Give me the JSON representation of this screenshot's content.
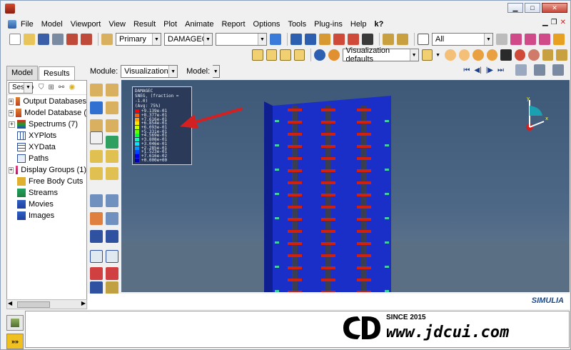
{
  "window": {
    "minimize": "▁",
    "maximize": "□",
    "close": "✕"
  },
  "menu": [
    {
      "label": "File"
    },
    {
      "label": "Model"
    },
    {
      "label": "Viewport"
    },
    {
      "label": "View"
    },
    {
      "label": "Result"
    },
    {
      "label": "Plot"
    },
    {
      "label": "Animate"
    },
    {
      "label": "Report"
    },
    {
      "label": "Options"
    },
    {
      "label": "Tools"
    },
    {
      "label": "Plug-ins"
    },
    {
      "label": "Help"
    },
    {
      "label": "k?"
    }
  ],
  "toolbar": {
    "primary_combo": "Primary",
    "field_combo": "DAMAGEC",
    "empty_combo": "",
    "selection_combo": "All",
    "vis_defaults": "Visualization defaults"
  },
  "tabs": {
    "model": "Model",
    "results": "Results"
  },
  "module": {
    "label": "Module:",
    "value": "Visualization",
    "model_label": "Model:"
  },
  "tree": {
    "session_combo": "Sessio",
    "items": [
      {
        "label": "Output Databases",
        "expandable": true
      },
      {
        "label": "Model Database (",
        "expandable": true
      },
      {
        "label": "Spectrums (7)",
        "expandable": true
      },
      {
        "label": "XYPlots",
        "expandable": false
      },
      {
        "label": "XYData",
        "expandable": false
      },
      {
        "label": "Paths",
        "expandable": false
      },
      {
        "label": "Display Groups (1)",
        "expandable": true
      },
      {
        "label": "Free Body Cuts",
        "expandable": false
      },
      {
        "label": "Streams",
        "expandable": false
      },
      {
        "label": "Movies",
        "expandable": false
      },
      {
        "label": "Images",
        "expandable": false
      }
    ]
  },
  "legend": {
    "title": "DAMAGEC",
    "subtitle": "SNEG, (fraction = -1.0)",
    "avg": "(Avg: 75%)",
    "values": [
      "+9.139e-01",
      "+8.377e-01",
      "+7.616e-01",
      "+6.854e-01",
      "+6.093e-01",
      "+5.331e-01",
      "+4.569e-01",
      "+3.808e-01",
      "+3.046e-01",
      "+2.285e-01",
      "+1.523e-01",
      "+7.616e-02",
      "+0.000e+00"
    ],
    "colors": [
      "#ff0000",
      "#ff5a00",
      "#ffa000",
      "#ffe000",
      "#c8ff00",
      "#64ff00",
      "#00ff3c",
      "#00ffb4",
      "#00e6ff",
      "#0096ff",
      "#0046ff",
      "#0000e6",
      "#0000b4"
    ]
  },
  "branding": {
    "simulia": "SIMULIA"
  },
  "watermark": {
    "since": "SINCE 2015",
    "url": "www.jdcui.com"
  }
}
